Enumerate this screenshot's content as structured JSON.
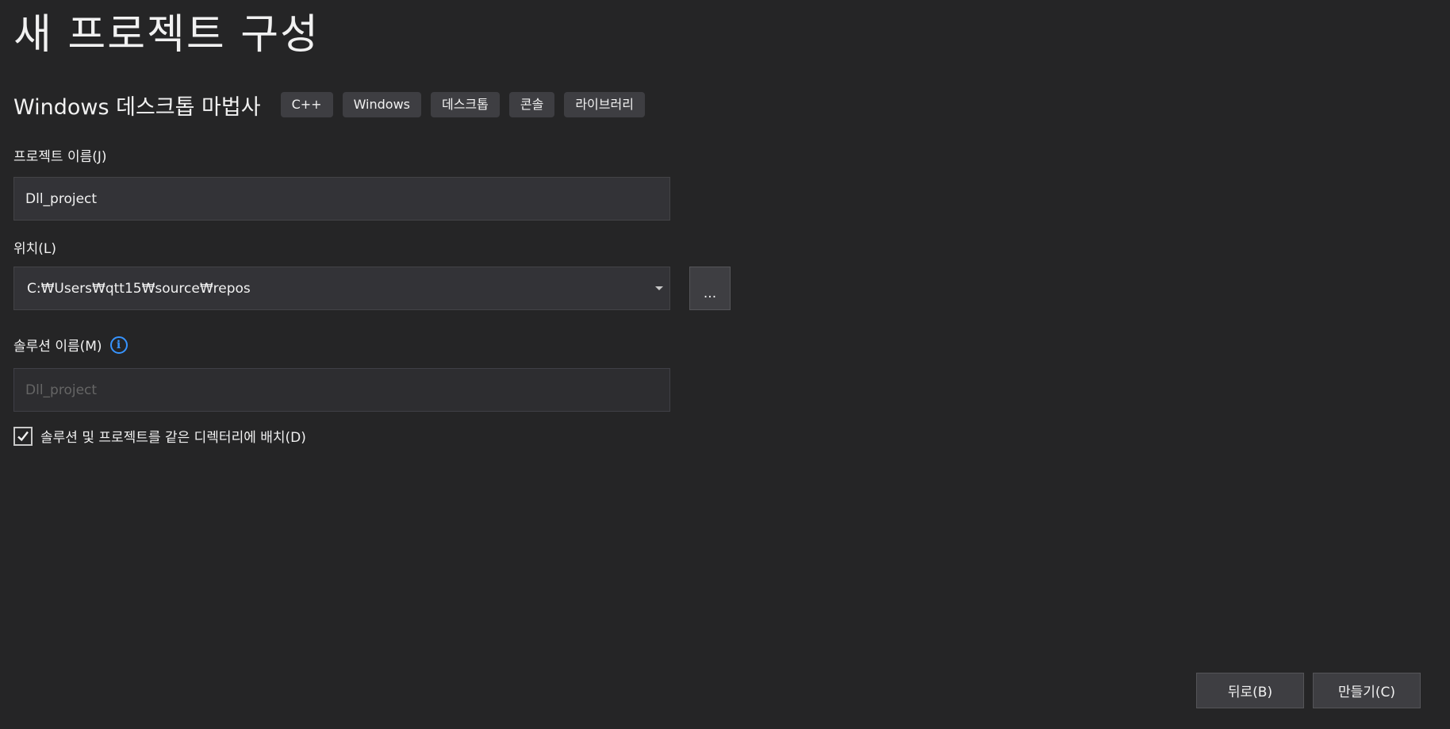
{
  "page": {
    "title": "새 프로젝트 구성"
  },
  "template": {
    "name": "Windows 데스크톱 마법사",
    "tags": [
      "C++",
      "Windows",
      "데스크톱",
      "콘솔",
      "라이브러리"
    ]
  },
  "project_name": {
    "label": "프로젝트 이름(J)",
    "value": "Dll_project"
  },
  "location": {
    "label": "위치(L)",
    "value": "C:₩Users₩qtt15₩source₩repos",
    "browse_label": "..."
  },
  "solution_name": {
    "label": "솔루션 이름(M)",
    "info_icon": "info-icon",
    "placeholder": "Dll_project"
  },
  "same_directory": {
    "label": "솔루션 및 프로젝트를 같은 디렉터리에 배치(D)",
    "checked": true
  },
  "footer": {
    "back_label": "뒤로(B)",
    "create_label": "만들기(C)"
  },
  "colors": {
    "background": "#252526",
    "text": "#f1f1f1",
    "field_background": "#333337",
    "button_background": "#3e3e42",
    "info_accent": "#3794ff"
  }
}
